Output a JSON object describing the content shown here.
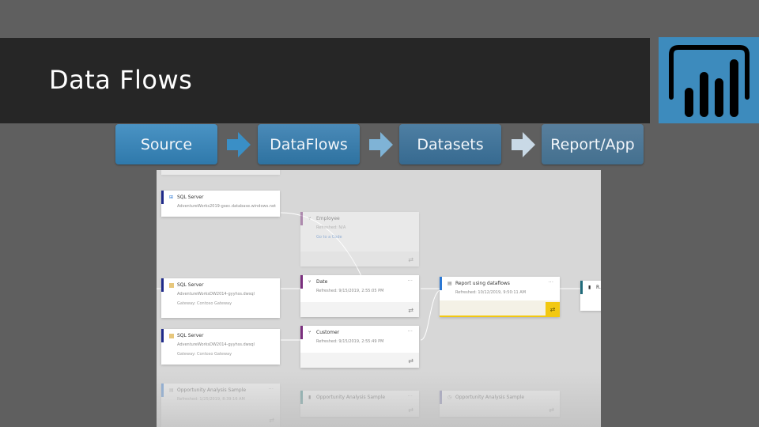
{
  "slide": {
    "title": "Data Flows",
    "logo_icon": "power-bi-logo-icon",
    "colors": {
      "title_bar": "#262626",
      "background": "#5f5f5f",
      "logo_background": "#3d8bbd",
      "step_blue": "#3a86b9",
      "highlight_yellow": "#f2c811"
    }
  },
  "steps": [
    {
      "label": "Source"
    },
    {
      "label": "DataFlows"
    },
    {
      "label": "Datasets"
    },
    {
      "label": "Report/App"
    }
  ],
  "lineage": {
    "sources": [
      {
        "type": "SQL Server",
        "server": "AdventureWorks2019-gsec.database.windows.net",
        "gateway": ""
      },
      {
        "type": "SQL Server",
        "server": "AdventureWorksDW2014-gyyhss.dwsql",
        "gateway": "Gateway: Contoso Gateway"
      },
      {
        "type": "SQL Server",
        "server": "AdventureWorksDW2014-gyyhss.dwsql",
        "gateway": "Gateway: Contoso Gateway"
      },
      {
        "type": "Opportunity Analysis Sample",
        "server": "Refreshed: 1/25/2019, 8:39:16 AM",
        "gateway": ""
      }
    ],
    "dataflows": [
      {
        "name": "Employee",
        "refreshed": "Refreshed: N/A",
        "link": "Go to a Code"
      },
      {
        "name": "Date",
        "refreshed": "Refreshed: 9/15/2019, 2:55:05 PM"
      },
      {
        "name": "Customer",
        "refreshed": "Refreshed: 9/15/2019, 2:55:49 PM"
      },
      {
        "name": "Opportunity Analysis Sample",
        "refreshed": ""
      }
    ],
    "datasets": [
      {
        "name": "Report using dataflows",
        "refreshed": "Refreshed: 10/12/2019, 9:50:11 AM"
      },
      {
        "name": "Opportunity Analysis Sample",
        "refreshed": ""
      }
    ],
    "reports": [
      {
        "name": "R..."
      }
    ],
    "more_label": "···",
    "refresh_glyph": "⇄"
  }
}
